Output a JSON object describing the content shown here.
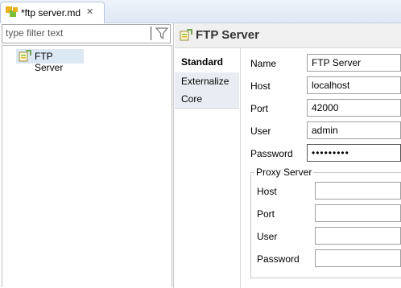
{
  "editor_tab": {
    "title": "*ftp server.md",
    "close_glyph": "✕",
    "icon": "model-file-icon"
  },
  "filter": {
    "placeholder": "type filter text",
    "icon": "filter-funnel-icon"
  },
  "tree": {
    "items": [
      {
        "label": "FTP Server",
        "icon": "ftp-server-icon",
        "selected": true
      }
    ]
  },
  "details": {
    "title": "FTP Server",
    "icon": "ftp-server-icon",
    "tabs": [
      {
        "label": "Standard",
        "active": true
      },
      {
        "label": "Externalize",
        "active": false
      },
      {
        "label": "Core",
        "active": false
      }
    ],
    "fields": {
      "name": {
        "label": "Name",
        "value": "FTP Server"
      },
      "host": {
        "label": "Host",
        "value": "localhost"
      },
      "port": {
        "label": "Port",
        "value": "42000"
      },
      "user": {
        "label": "User",
        "value": "admin"
      },
      "password": {
        "label": "Password",
        "value": "•••••••••"
      }
    },
    "proxy": {
      "title": "Proxy Server",
      "host": {
        "label": "Host",
        "value": ""
      },
      "port": {
        "label": "Port",
        "value": ""
      },
      "user": {
        "label": "User",
        "value": ""
      },
      "password": {
        "label": "Password",
        "value": ""
      }
    }
  }
}
